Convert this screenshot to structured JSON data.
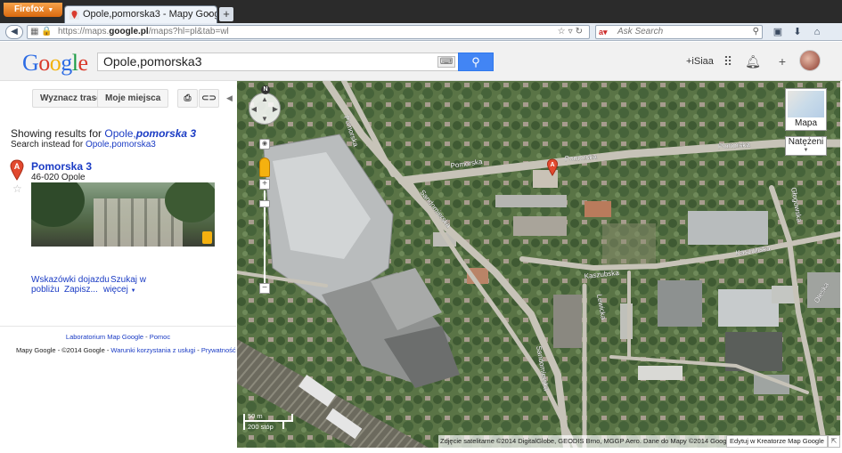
{
  "browser": {
    "menu_label": "Firefox",
    "tab_title": "Opole,pomorska3 - Mapy Google",
    "url_prefix": "https://maps.",
    "url_domain": "google.pl",
    "url_suffix": "/maps?hl=pl&tab=wl",
    "search_placeholder": "Ask Search"
  },
  "header": {
    "logo_letters": [
      "G",
      "o",
      "o",
      "g",
      "l",
      "e"
    ],
    "search_value": "Opole,pomorska3",
    "user_name": "+iSiaa"
  },
  "left_panel": {
    "route_button": "Wyznacz trasę",
    "places_button": "Moje miejsca",
    "showing_prefix": "Showing results for ",
    "showing_query_plain": "Opole,",
    "showing_query_emph": "pomorska 3",
    "instead_prefix": "Search instead for ",
    "instead_query": "Opole,pomorska3",
    "result": {
      "marker": "A",
      "name": "Pomorska 3",
      "address": "46-020 Opole"
    },
    "links": {
      "directions": "Wskazówki dojazdu",
      "search_nearby_1": "Szukaj w",
      "search_nearby_2": "pobliżu",
      "save": "Zapisz...",
      "more": "więcej"
    },
    "footer": {
      "lab": "Laboratorium Map Google",
      "separator": " - ",
      "help": "Pomoc",
      "copyright": "Mapy Google - ©2014 Google - ",
      "terms": "Warunki korzystania z usługi",
      "privacy": "Prywatność"
    }
  },
  "map": {
    "compass": "N",
    "maptype_label": "Mapa",
    "traffic_label": "Natężeni",
    "scale_top": "50 m",
    "scale_bottom": "200 stóp",
    "attribution": "Zdjęcie satelitarne ©2014 DigitalGlobe, GEODIS Brno, MGGP Aero. Dane do Mapy ©2014 Google - ",
    "mapmaker_link": "Edytuj w Kreatorze Map Google",
    "marker_label": "A",
    "streets": {
      "pomorska_left": "Pomorska",
      "pomorska": "Pomorska",
      "pomorska_right": "Pomorska",
      "sandomierska": "Sandomierska",
      "kaszubska_1": "Kaszubska",
      "kaszubska_2": "Kaszubska",
      "glogowska": "Głogowska",
      "sandomierska_2": "Sandomierska",
      "lewicka": "Lewicka",
      "oleska": "Oleska"
    }
  }
}
